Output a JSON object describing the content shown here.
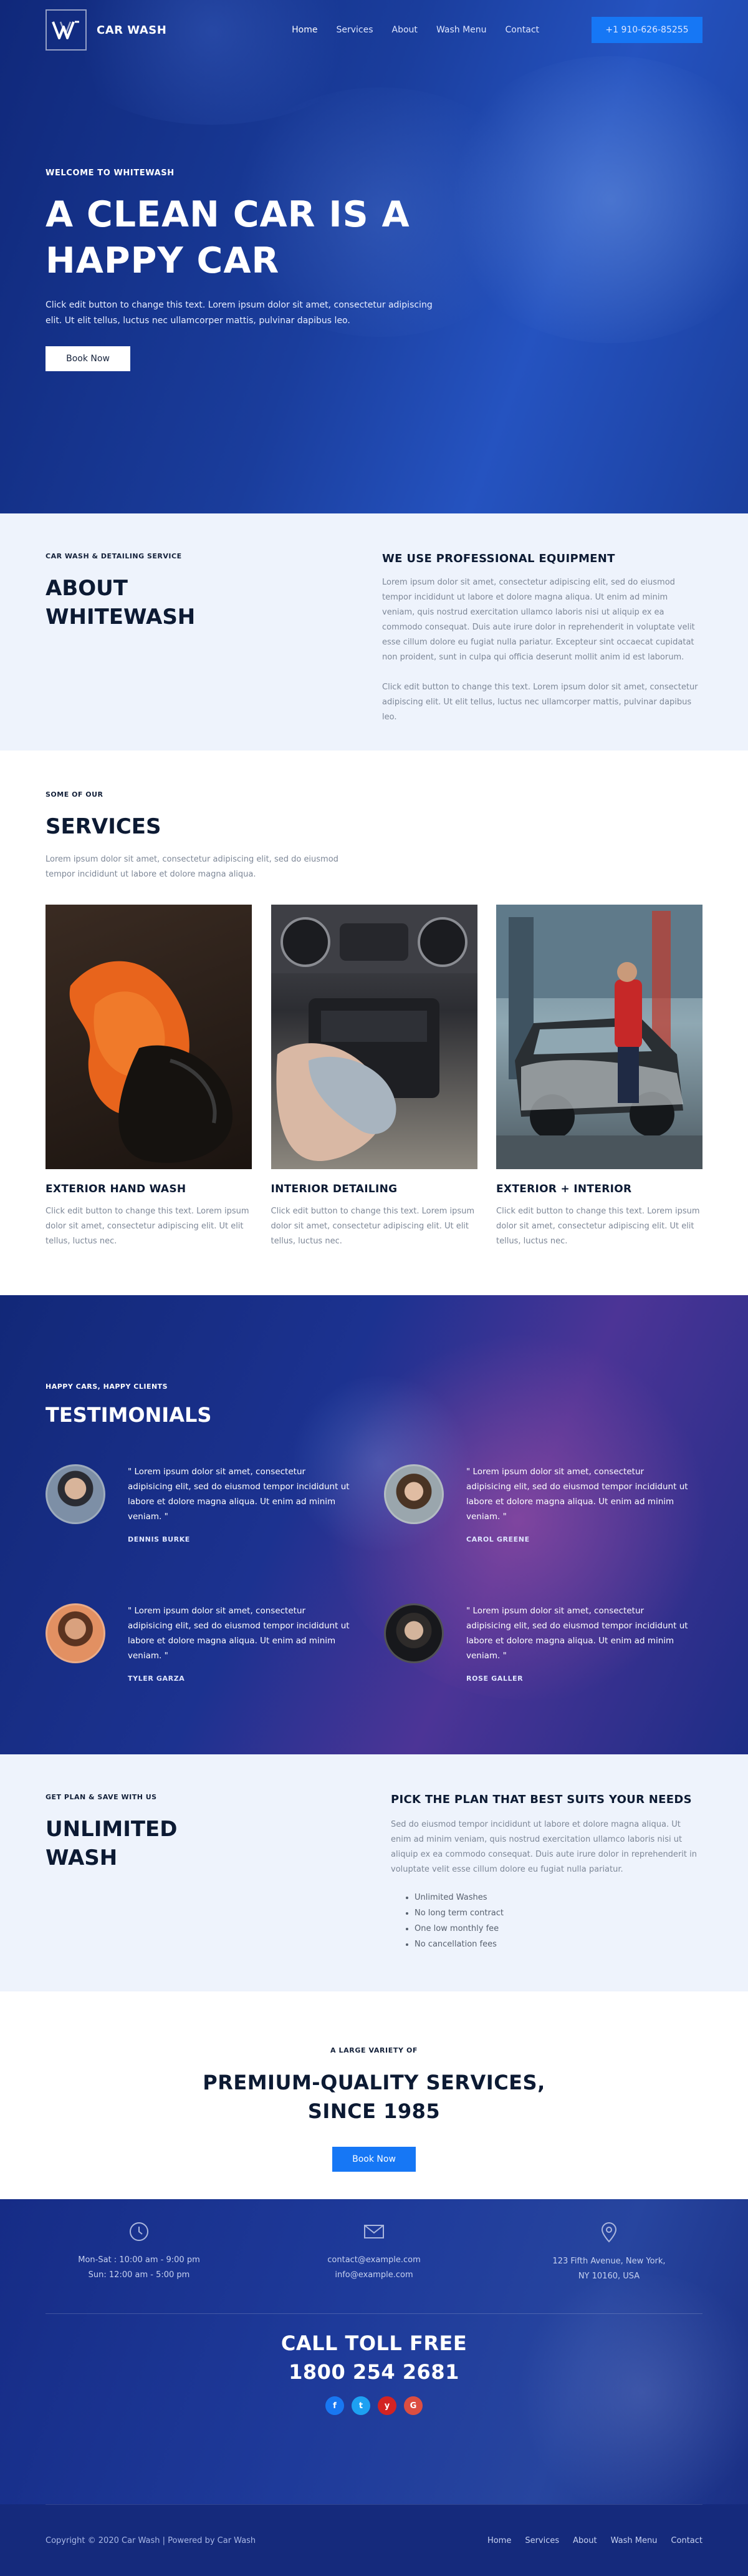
{
  "nav": {
    "brand": "CAR WASH",
    "items": [
      {
        "label": "Home"
      },
      {
        "label": "Services"
      },
      {
        "label": "About"
      },
      {
        "label": "Wash Menu"
      },
      {
        "label": "Contact"
      }
    ],
    "phone": "+1 910-626-85255"
  },
  "hero": {
    "eyebrow": "WELCOME TO WHITEWASH",
    "title_line1": "A CLEAN CAR IS A",
    "title_line2": "HAPPY CAR",
    "text": "Click edit button to change this text. Lorem ipsum dolor sit amet, consectetur adipiscing elit. Ut elit tellus, luctus nec ullamcorper mattis, pulvinar dapibus leo.",
    "button": "Book Now"
  },
  "about": {
    "eyebrow": "CAR WASH & DETAILING SERVICE",
    "title_line1": "ABOUT",
    "title_line2": "WHITEWASH",
    "heading": "WE USE PROFESSIONAL EQUIPMENT",
    "p1": "Lorem ipsum dolor sit amet, consectetur adipiscing elit, sed do eiusmod tempor incididunt ut labore et dolore magna aliqua. Ut enim ad minim veniam, quis nostrud exercitation ullamco laboris nisi ut aliquip ex ea commodo consequat. Duis aute irure dolor in reprehenderit in voluptate velit esse cillum dolore eu fugiat nulla pariatur. Excepteur sint occaecat cupidatat non proident, sunt in culpa qui officia deserunt mollit anim id est laborum.",
    "p2": "Click edit button to change this text. Lorem ipsum dolor sit amet, consectetur adipiscing elit. Ut elit tellus, luctus nec ullamcorper mattis, pulvinar dapibus leo."
  },
  "services": {
    "eyebrow": "SOME OF OUR",
    "title": "SERVICES",
    "intro": "Lorem ipsum dolor sit amet, consectetur adipiscing elit, sed do eiusmod tempor incididunt ut labore et dolore magna aliqua.",
    "cards": [
      {
        "title": "EXTERIOR HAND WASH",
        "text": "Click edit button to change this text. Lorem ipsum dolor sit amet, consectetur adipiscing elit. Ut elit tellus, luctus nec."
      },
      {
        "title": "INTERIOR DETAILING",
        "text": "Click edit button to change this text. Lorem ipsum dolor sit amet, consectetur adipiscing elit. Ut elit tellus, luctus nec."
      },
      {
        "title": "EXTERIOR + INTERIOR",
        "text": "Click edit button to change this text. Lorem ipsum dolor sit amet, consectetur adipiscing elit. Ut elit tellus, luctus nec."
      }
    ]
  },
  "testimonials": {
    "eyebrow": "HAPPY CARS, HAPPY CLIENTS",
    "title": "TESTIMONIALS",
    "items": [
      {
        "quote": "\" Lorem ipsum dolor sit amet, consectetur adipisicing elit, sed do eiusmod tempor incididunt ut labore et dolore magna aliqua. Ut enim ad minim veniam. \"",
        "name": "DENNIS BURKE"
      },
      {
        "quote": "\" Lorem ipsum dolor sit amet, consectetur adipisicing elit, sed do eiusmod tempor incididunt ut labore et dolore magna aliqua. Ut enim ad minim veniam. \"",
        "name": "CAROL GREENE"
      },
      {
        "quote": "\" Lorem ipsum dolor sit amet, consectetur adipisicing elit, sed do eiusmod tempor incididunt ut labore et dolore magna aliqua. Ut enim ad minim veniam. \"",
        "name": "TYLER GARZA"
      },
      {
        "quote": "\" Lorem ipsum dolor sit amet, consectetur adipisicing elit, sed do eiusmod tempor incididunt ut labore et dolore magna aliqua. Ut enim ad minim veniam. \"",
        "name": "ROSE GALLER"
      }
    ]
  },
  "plan": {
    "eyebrow": "GET PLAN & SAVE WITH US",
    "title_line1": "UNLIMITED",
    "title_line2": "WASH",
    "heading": "PICK THE PLAN THAT BEST SUITS YOUR NEEDS",
    "text": "Sed do eiusmod tempor incididunt ut labore et dolore magna aliqua. Ut enim ad minim veniam, quis nostrud exercitation ullamco laboris nisi ut aliquip ex ea commodo consequat. Duis aute irure dolor in reprehenderit in voluptate velit esse cillum dolore eu fugiat nulla pariatur.",
    "features": [
      "Unlimited Washes",
      "No long term contract",
      "One low monthly fee",
      "No cancellation fees"
    ]
  },
  "premium": {
    "eyebrow": "A LARGE VARIETY OF",
    "title_line1": "PREMIUM-QUALITY SERVICES,",
    "title_line2": "SINCE 1985",
    "button": "Book Now"
  },
  "contact": {
    "hours_line1": "Mon-Sat : 10:00 am - 9:00 pm",
    "hours_line2": "Sun: 12:00 am - 5:00 pm",
    "email_line1": "contact@example.com",
    "email_line2": "info@example.com",
    "address_line1": "123 Fifth Avenue, New York,",
    "address_line2": "NY 10160, USA",
    "tollfree_label": "CALL TOLL FREE",
    "tollfree_number": "1800 254 2681",
    "socials": [
      {
        "icon": "facebook-icon",
        "glyph": "f",
        "color": "#1877f2"
      },
      {
        "icon": "twitter-icon",
        "glyph": "t",
        "color": "#1da1f2"
      },
      {
        "icon": "yelp-icon",
        "glyph": "y",
        "color": "#d32323"
      },
      {
        "icon": "google-icon",
        "glyph": "G",
        "color": "#dc4e41"
      }
    ]
  },
  "footer": {
    "copyright": "Copyright © 2020 Car Wash | Powered by Car Wash",
    "items": [
      {
        "label": "Home"
      },
      {
        "label": "Services"
      },
      {
        "label": "About"
      },
      {
        "label": "Wash Menu"
      },
      {
        "label": "Contact"
      }
    ]
  },
  "colors": {
    "accent": "#1677f5",
    "navy": "#0c1a33",
    "hero_blue": "#1a3d9c",
    "light_bg": "#eef3fc"
  }
}
